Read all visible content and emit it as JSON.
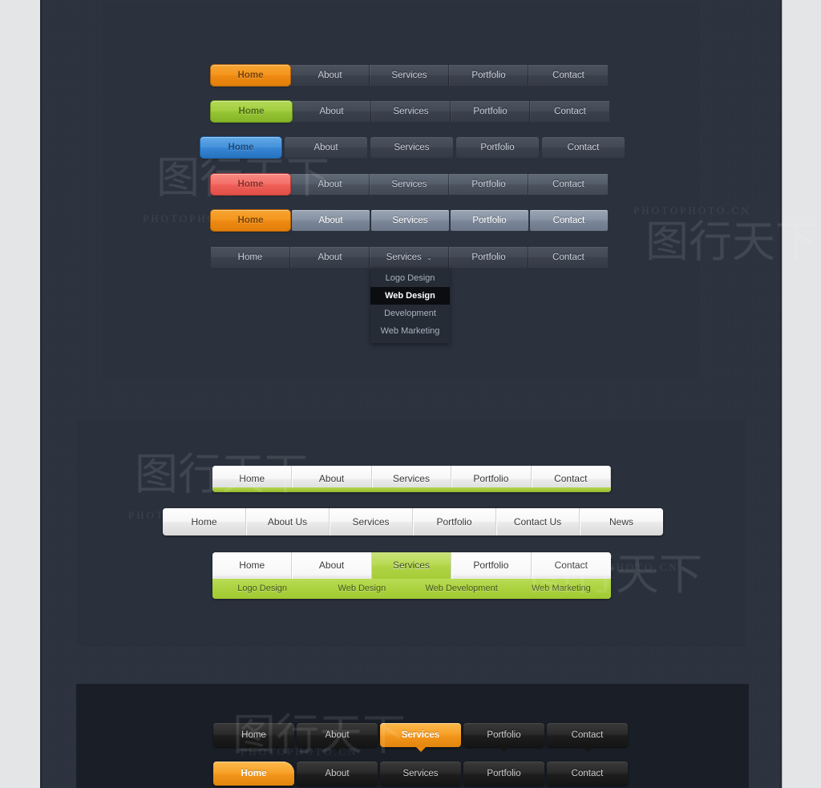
{
  "theme": {
    "page_bg": "#e3e5e7",
    "dark_bg": "#2c333f",
    "panel_dark": "#2b323e",
    "panel_black": "#191e27",
    "accent_orange": "#f3951d",
    "accent_green": "#a2ce40",
    "accent_blue": "#4592dc",
    "accent_red": "#f4706a"
  },
  "watermarks": {
    "left": "图行天下",
    "right": "PHOTOPHOTO.CN",
    "bottom": "PHOTOPHOTO.CN"
  },
  "section_dark": {
    "menus": [
      {
        "name": "orange-flat-menu",
        "accent": "orange",
        "items": [
          {
            "label": "Home",
            "active": true
          },
          {
            "label": "About",
            "active": false
          },
          {
            "label": "Services",
            "active": false
          },
          {
            "label": "Portfolio",
            "active": false
          },
          {
            "label": "Contact",
            "active": false
          }
        ]
      },
      {
        "name": "green-flat-menu",
        "accent": "green",
        "items": [
          {
            "label": "Home",
            "active": true
          },
          {
            "label": "About",
            "active": false
          },
          {
            "label": "Services",
            "active": false
          },
          {
            "label": "Portfolio",
            "active": false
          },
          {
            "label": "Contact",
            "active": false
          }
        ]
      },
      {
        "name": "blue-segmented-menu",
        "accent": "blue",
        "items": [
          {
            "label": "Home",
            "active": true
          },
          {
            "label": "About",
            "active": false
          },
          {
            "label": "Services",
            "active": false
          },
          {
            "label": "Portfolio",
            "active": false
          },
          {
            "label": "Contact",
            "active": false
          }
        ]
      },
      {
        "name": "red-glossy-menu",
        "accent": "red",
        "items": [
          {
            "label": "Home",
            "active": true
          },
          {
            "label": "About",
            "active": false
          },
          {
            "label": "Services",
            "active": false
          },
          {
            "label": "Portfolio",
            "active": false
          },
          {
            "label": "Contact",
            "active": false
          }
        ]
      },
      {
        "name": "orange-slate-menu",
        "accent": "orange",
        "items": [
          {
            "label": "Home",
            "active": true
          },
          {
            "label": "About",
            "active": false
          },
          {
            "label": "Services",
            "active": false
          },
          {
            "label": "Portfolio",
            "active": false
          },
          {
            "label": "Contact",
            "active": false
          }
        ]
      },
      {
        "name": "dropdown-menu",
        "accent": "none",
        "items": [
          {
            "label": "Home",
            "active": false
          },
          {
            "label": "About",
            "active": false
          },
          {
            "label": "Services",
            "active": false,
            "has_chevron": true,
            "chevron": "⌄"
          },
          {
            "label": "Portfolio",
            "active": false
          },
          {
            "label": "Contact",
            "active": false
          }
        ],
        "dropdown": {
          "parent": "Services",
          "items": [
            {
              "label": "Logo Design",
              "active": false
            },
            {
              "label": "Web Design",
              "active": true
            },
            {
              "label": "Development",
              "active": false
            },
            {
              "label": "Web Marketing",
              "active": false
            }
          ]
        }
      }
    ]
  },
  "section_light": {
    "menus": [
      {
        "name": "light-green-underline-menu",
        "items": [
          {
            "label": "Home",
            "active": false
          },
          {
            "label": "About",
            "active": false
          },
          {
            "label": "Services",
            "active": false
          },
          {
            "label": "Portfolio",
            "active": false
          },
          {
            "label": "Contact",
            "active": false
          }
        ]
      },
      {
        "name": "light-wide-menu",
        "items": [
          {
            "label": "Home",
            "active": false
          },
          {
            "label": "About Us",
            "active": false
          },
          {
            "label": "Services",
            "active": false
          },
          {
            "label": "Portfolio",
            "active": false
          },
          {
            "label": "Contact Us",
            "active": false
          },
          {
            "label": "News",
            "active": false
          }
        ]
      },
      {
        "name": "light-green-active-menu",
        "items": [
          {
            "label": "Home",
            "active": false
          },
          {
            "label": "About",
            "active": false
          },
          {
            "label": "Services",
            "active": true
          },
          {
            "label": "Portfolio",
            "active": false
          },
          {
            "label": "Contact",
            "active": false
          }
        ],
        "submenu": [
          {
            "label": "Logo Design"
          },
          {
            "label": "Web Design"
          },
          {
            "label": "Web Development"
          },
          {
            "label": "Web Marketing"
          }
        ]
      }
    ]
  },
  "section_black": {
    "menus": [
      {
        "name": "black-orange-services-menu",
        "items": [
          {
            "label": "Home",
            "active": false
          },
          {
            "label": "About",
            "active": false
          },
          {
            "label": "Services",
            "active": true
          },
          {
            "label": "Portfolio",
            "active": false
          },
          {
            "label": "Contact",
            "active": false
          }
        ]
      },
      {
        "name": "black-orange-home-menu",
        "items": [
          {
            "label": "Home",
            "active": true
          },
          {
            "label": "About",
            "active": false
          },
          {
            "label": "Services",
            "active": false
          },
          {
            "label": "Portfolio",
            "active": false
          },
          {
            "label": "Contact",
            "active": false
          }
        ]
      }
    ]
  }
}
